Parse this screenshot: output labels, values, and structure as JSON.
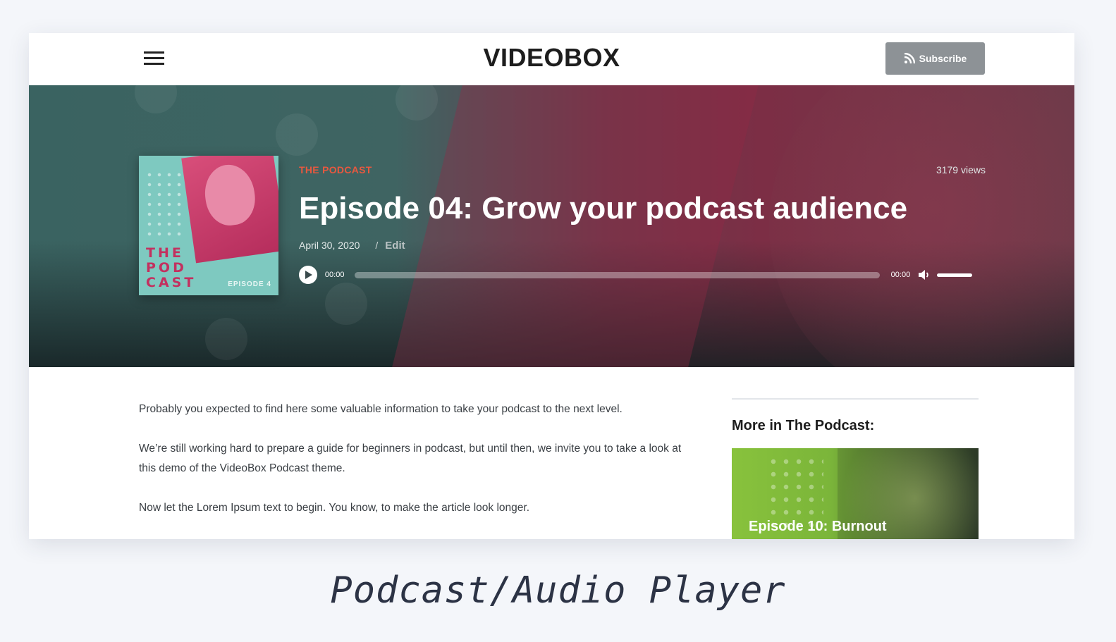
{
  "header": {
    "logo": "VIDEOBOX",
    "subscribe_label": "Subscribe",
    "menu_icon": "hamburger-icon",
    "subscribe_icon": "rss-icon"
  },
  "episode": {
    "category": "THE PODCAST",
    "views": "3179 views",
    "title": "Episode 04: Grow your podcast audience",
    "date": "April 30, 2020",
    "separator": "/",
    "edit_label": "Edit",
    "cover": {
      "line1": "THE",
      "line2": "POD",
      "line3": "CAST",
      "episode_tag": "EPISODE 4"
    }
  },
  "player": {
    "current_time": "00:00",
    "duration": "00:00",
    "progress": 0,
    "volume": 1,
    "play_icon": "play-icon",
    "mute_icon": "speaker-icon"
  },
  "article": {
    "paragraphs": [
      "Probably you expected to find here some valuable information to take your podcast to the next level.",
      "We’re still working hard to prepare a guide for beginners in podcast, but until then, we invite you to take a look at this demo of the VideoBox Podcast theme.",
      "Now let the Lorem Ipsum text to begin. You know, to make the article look longer."
    ]
  },
  "sidebar": {
    "heading": "More in The Podcast:",
    "card_title": "Episode 10: Burnout"
  },
  "caption": "Podcast/Audio  Player",
  "colors": {
    "accent": "#e8583f",
    "subscribe_bg": "#8d9296",
    "page_bg": "#f4f6fa"
  }
}
